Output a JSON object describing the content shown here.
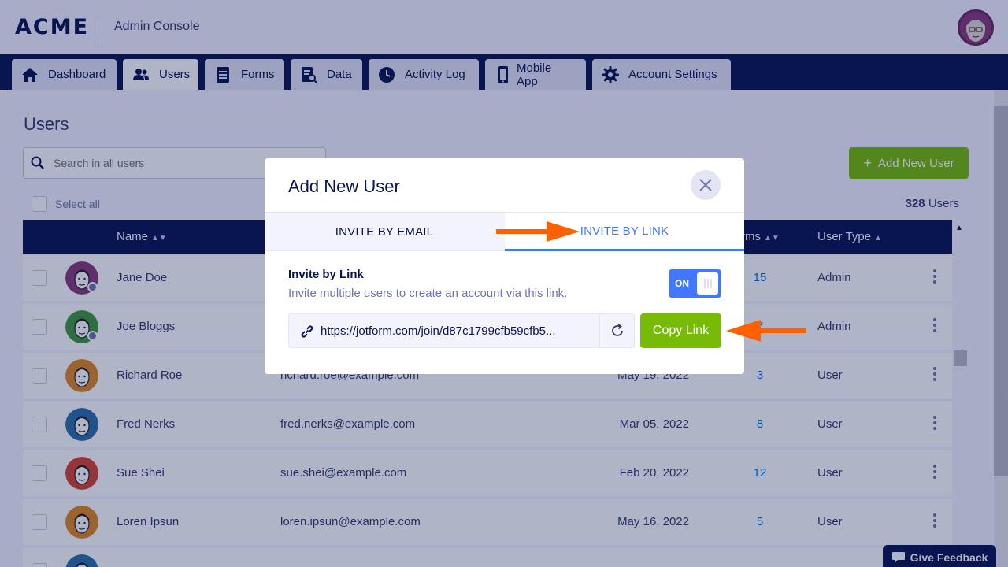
{
  "header": {
    "logo": "ACME",
    "console_title": "Admin Console"
  },
  "nav": {
    "tabs": [
      {
        "label": "Dashboard",
        "icon": "home-icon"
      },
      {
        "label": "Users",
        "icon": "users-icon",
        "active": true
      },
      {
        "label": "Forms",
        "icon": "forms-icon"
      },
      {
        "label": "Data",
        "icon": "data-icon"
      },
      {
        "label": "Activity Log",
        "icon": "clock-icon"
      },
      {
        "label": "Mobile App",
        "icon": "mobile-icon"
      },
      {
        "label": "Account Settings",
        "icon": "gear-icon"
      }
    ]
  },
  "users_page": {
    "title": "Users",
    "search_placeholder": "Search in all users",
    "add_user_label": "Add New User",
    "select_all_label": "Select all",
    "count_number": "328",
    "count_label": "Users",
    "columns": {
      "name": "Name",
      "forms": "rms",
      "user_type": "User Type"
    },
    "rows": [
      {
        "name": "Jane Doe",
        "email": "",
        "date": "",
        "forms": "15",
        "type": "Admin",
        "avatar_color": "#8b3a7a"
      },
      {
        "name": "Joe Bloggs",
        "email": "",
        "date": "",
        "forms": "7",
        "type": "Admin",
        "avatar_color": "#3f9a3a"
      },
      {
        "name": "Richard Roe",
        "email": "richard.roe@example.com",
        "date": "May 19, 2022",
        "forms": "3",
        "type": "User",
        "avatar_color": "#e08a1e"
      },
      {
        "name": "Fred Nerks",
        "email": "fred.nerks@example.com",
        "date": "Mar 05, 2022",
        "forms": "8",
        "type": "User",
        "avatar_color": "#2f6fa8"
      },
      {
        "name": "Sue Shei",
        "email": "sue.shei@example.com",
        "date": "Feb 20, 2022",
        "forms": "12",
        "type": "User",
        "avatar_color": "#d9442e"
      },
      {
        "name": "Loren Ipsun",
        "email": "loren.ipsun@example.com",
        "date": "May 16, 2022",
        "forms": "5",
        "type": "User",
        "avatar_color": "#e08a1e"
      },
      {
        "name": "",
        "email": "",
        "date": "",
        "forms": "",
        "type": "",
        "avatar_color": "#2f6fa8"
      }
    ]
  },
  "modal": {
    "title": "Add New User",
    "tab_email": "INVITE BY EMAIL",
    "tab_link": "INVITE BY LINK",
    "invite_title": "Invite by Link",
    "invite_subtitle": "Invite multiple users to create an account via this link.",
    "toggle_label": "ON",
    "link_url": "https://jotform.com/join/d87c1799cfb59cfb5...",
    "copy_label": "Copy Link"
  },
  "feedback_label": "Give Feedback",
  "colors": {
    "navy": "#0a1551",
    "green": "#78bb07",
    "blue": "#4277ff",
    "arrow_orange": "#ff6100"
  }
}
